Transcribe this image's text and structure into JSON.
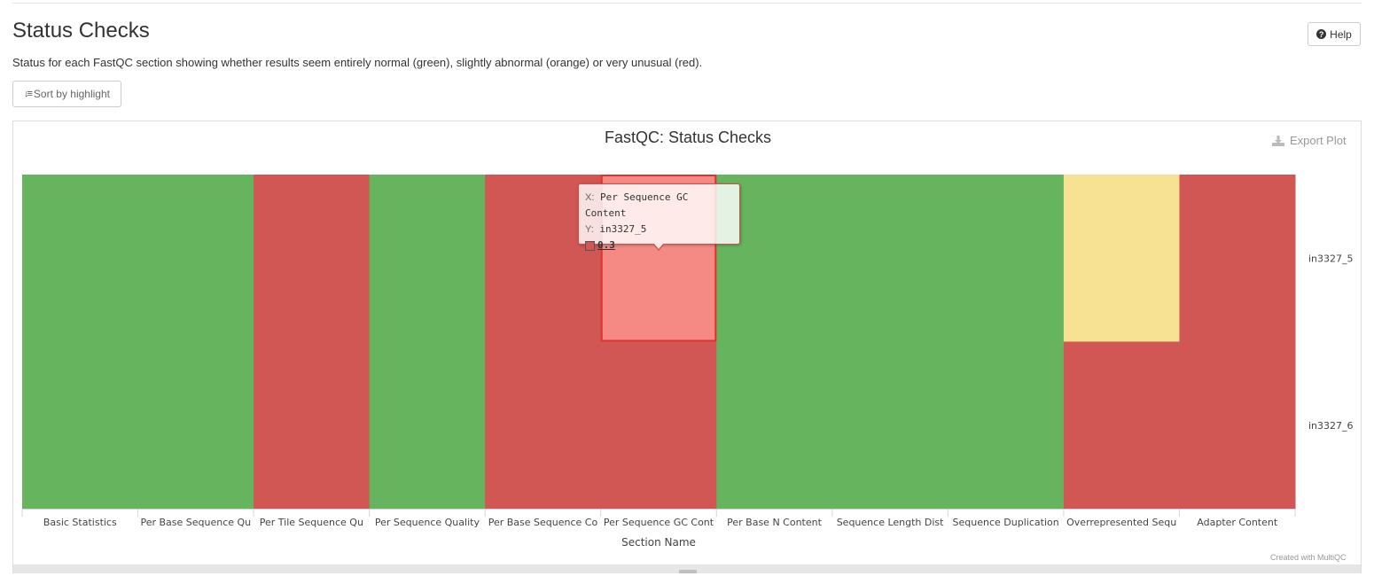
{
  "page": {
    "title": "Status Checks",
    "description": "Status for each FastQC section showing whether results seem entirely normal (green), slightly abnormal (orange) or very unusual (red).",
    "help_label": "Help",
    "sort_label": "Sort by highlight",
    "export_label": "Export Plot",
    "credit": "Created with MultiQC"
  },
  "icons": {
    "help": "question-circle-icon",
    "sort": "sort-amount-icon",
    "export": "download-icon",
    "resize": "resize-handle-icon"
  },
  "colors": {
    "pass": "#66b55e",
    "warn": "#f7e192",
    "fail": "#d05754",
    "hover": "#f58a84"
  },
  "chart_data": {
    "type": "heatmap",
    "title": "FastQC: Status Checks",
    "xlabel": "Section Name",
    "ylabel": "",
    "categories": [
      "Basic Statistics",
      "Per Base Sequence Qu",
      "Per Tile Sequence Qu",
      "Per Sequence Quality",
      "Per Base Sequence Co",
      "Per Sequence GC Cont",
      "Per Base N Content",
      "Sequence Length Dist",
      "Sequence Duplication",
      "Overrepresented Sequ",
      "Adapter Content"
    ],
    "rows": [
      "in3327_5",
      "in3327_6"
    ],
    "series": [
      {
        "name": "in3327_5",
        "values": [
          1,
          1,
          0.3,
          1,
          0.3,
          0.3,
          1,
          1,
          1,
          0.6,
          0.3
        ]
      },
      {
        "name": "in3327_6",
        "values": [
          1,
          1,
          0.3,
          1,
          0.3,
          0.3,
          1,
          1,
          1,
          0.3,
          0.3
        ]
      }
    ],
    "tooltip": {
      "x_label": "X:",
      "x": "Per Sequence GC Content",
      "y_label": "Y:",
      "y": "in3327_5",
      "value": "0.3"
    },
    "highlighted_cell": {
      "row": 0,
      "col": 5
    }
  }
}
